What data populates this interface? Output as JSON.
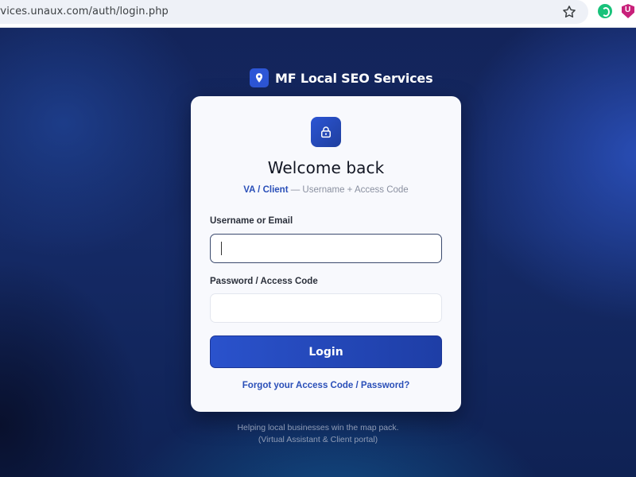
{
  "browser": {
    "url": "services.unaux.com/auth/login.php",
    "star_icon": "star-icon",
    "extension_icons": [
      "refresh-extension-icon",
      "shield-extension-icon"
    ],
    "extension_badge": "U"
  },
  "brand": {
    "name": "MF Local SEO Services",
    "icon": "map-pin-icon",
    "accent": "#2d56d6"
  },
  "card": {
    "icon": "lock-icon",
    "title": "Welcome back",
    "subtitle_role": "VA / Client",
    "subtitle_rest": " — Username + Access Code",
    "username_label": "Username or Email",
    "username_value": "",
    "password_label": "Password / Access Code",
    "password_value": "",
    "login_label": "Login",
    "forgot_label": "Forgot your Access Code / Password?"
  },
  "footer": {
    "line1": "Helping local businesses win the map pack.",
    "line2": "(Virtual Assistant & Client portal)"
  },
  "colors": {
    "background": "#13245a",
    "card": "#f8f9fd",
    "button": "#2a52cc",
    "link": "#2a4fb8"
  }
}
